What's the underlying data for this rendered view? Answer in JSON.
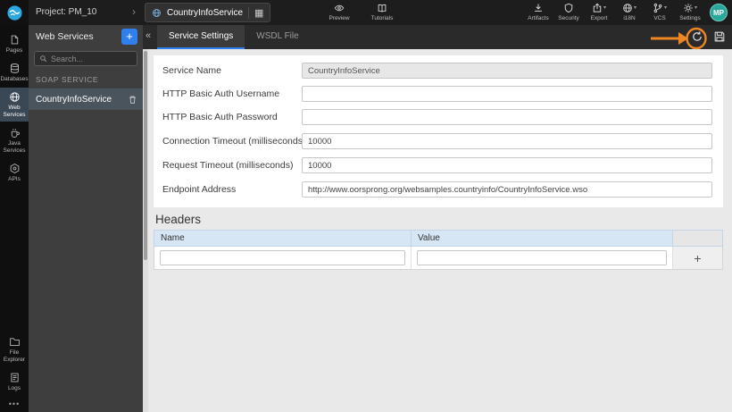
{
  "topbar": {
    "project_label": "Project: PM_10",
    "service_name": "CountryInfoService",
    "menu": {
      "preview": "Preview",
      "tutorials": "Tutorials",
      "artifacts": "Artifacts",
      "security": "Security",
      "export": "Export",
      "i18n": "i18N",
      "vcs": "VCS",
      "settings": "Settings"
    },
    "avatar_initials": "MP"
  },
  "rail": {
    "items": [
      {
        "label": "Pages"
      },
      {
        "label": "Databases"
      },
      {
        "label": "Web Services",
        "active": true
      },
      {
        "label": "Java Services"
      },
      {
        "label": "APIs"
      },
      {
        "label": "File Explorer"
      },
      {
        "label": "Logs"
      }
    ]
  },
  "panel": {
    "title": "Web Services",
    "search_placeholder": "Search...",
    "section_label": "SOAP SERVICE",
    "items": [
      {
        "name": "CountryInfoService",
        "selected": true
      }
    ]
  },
  "tabs": {
    "items": [
      {
        "label": "Service Settings",
        "active": true
      },
      {
        "label": "WSDL File",
        "active": false
      }
    ]
  },
  "form": {
    "fields": [
      {
        "label": "Service Name",
        "value": "CountryInfoService",
        "readonly": true
      },
      {
        "label": "HTTP Basic Auth Username",
        "value": ""
      },
      {
        "label": "HTTP Basic Auth Password",
        "value": ""
      },
      {
        "label": "Connection Timeout (milliseconds)",
        "value": "10000"
      },
      {
        "label": "Request Timeout (milliseconds)",
        "value": "10000"
      },
      {
        "label": "Endpoint Address",
        "value": "http://www.oorsprong.org/websamples.countryinfo/CountryInfoService.wso"
      }
    ]
  },
  "headers_section": {
    "title": "Headers",
    "columns": [
      "Name",
      "Value"
    ],
    "add_label": "+"
  },
  "icons": {
    "breadcrumb": "›",
    "grid": "▦",
    "chevron_down": "▾",
    "plus": "+",
    "collapse": "«",
    "more": "•••"
  },
  "colors": {
    "accent_blue": "#2f80ed",
    "annotation_orange": "#ee8722",
    "table_header_bg": "#d7e6f5",
    "avatar_teal": "#2aa79b"
  }
}
